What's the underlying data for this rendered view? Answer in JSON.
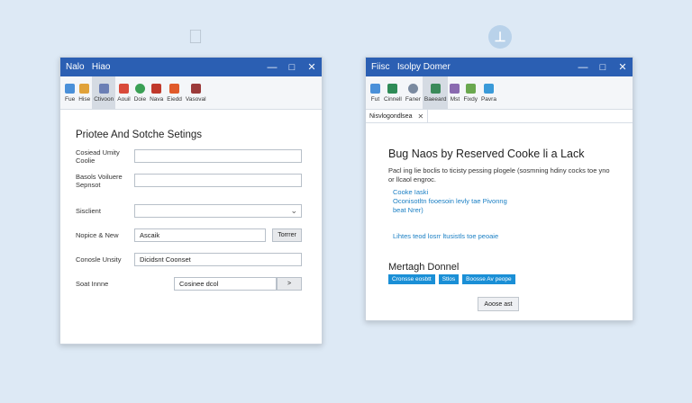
{
  "left_window": {
    "title": "Nalo   Hiao",
    "ribbon": [
      {
        "label": "Fue",
        "icon": "document-icon",
        "color": "#4a90d9"
      },
      {
        "label": "Hise",
        "icon": "folder-icon",
        "color": "#e0a23a"
      },
      {
        "label": "Ctivoon",
        "icon": "shield-icon",
        "color": "#6b7fb5"
      },
      {
        "label": "Aouil",
        "icon": "paint-icon",
        "color": "#d94a3a"
      },
      {
        "label": "Doie",
        "icon": "globe-icon",
        "color": "#3aa055"
      },
      {
        "label": "Nava",
        "icon": "mail-icon",
        "color": "#c0392b"
      },
      {
        "label": "Eiedd",
        "icon": "chart-icon",
        "color": "#e05a2a"
      },
      {
        "label": "Vasoval",
        "icon": "settings-icon",
        "color": "#9b3a3a"
      }
    ],
    "form": {
      "title": "Priotee And Sotche Setings",
      "rows": [
        {
          "label": "Cosiead Umity Coolie",
          "value": ""
        },
        {
          "label": "Basols Voiluere Sepnsot",
          "value": ""
        },
        {
          "label": "Sisclient",
          "value": ""
        },
        {
          "label": "Nopice & New",
          "value": "Ascaik",
          "button": "Torrrer"
        },
        {
          "label": "Conosle Unsity",
          "value": "Dicidsnt Coonset"
        },
        {
          "label": "Soat Innne",
          "value": "Cosinee dcol",
          "button": ">"
        }
      ]
    }
  },
  "right_window": {
    "title": "Fiisc   Isolpy Domer",
    "ribbon": [
      {
        "label": "Fut",
        "icon": "document-icon",
        "color": "#4a90d9"
      },
      {
        "label": "Cinnell",
        "icon": "folder-icon",
        "color": "#2e8b57"
      },
      {
        "label": "Faner",
        "icon": "gear-icon",
        "color": "#7a8aa0"
      },
      {
        "label": "Baeeard",
        "icon": "shield-icon",
        "color": "#3a8a5a"
      },
      {
        "label": "Mst",
        "icon": "tools-icon",
        "color": "#8a6ab0"
      },
      {
        "label": "Fixdy",
        "icon": "brush-icon",
        "color": "#6aa84f"
      },
      {
        "label": "Pavra",
        "icon": "bird-icon",
        "color": "#3a9ad9"
      }
    ],
    "tab": {
      "label": "Nisvlogondlsea"
    },
    "doc": {
      "title": "Bug Naos by Reserved Cooke li a Lack",
      "body": "Pacl ing lie boclis to ticisty pessing plogele (sosmning hdiny cocks toe yno or llcaol engroc.",
      "links": [
        "Cooke Iaski",
        "Oconisotltn fooesoin levly tae Pivonng",
        "beat Nrer)",
        "Lihtes teod losrr ltusistls toe peoaie"
      ],
      "section_title": "Mertagh Donnel",
      "pills": [
        "Cronsse eosbtt",
        "Stlos",
        "Boosse Av peope"
      ],
      "button": "Aoose ast"
    }
  }
}
